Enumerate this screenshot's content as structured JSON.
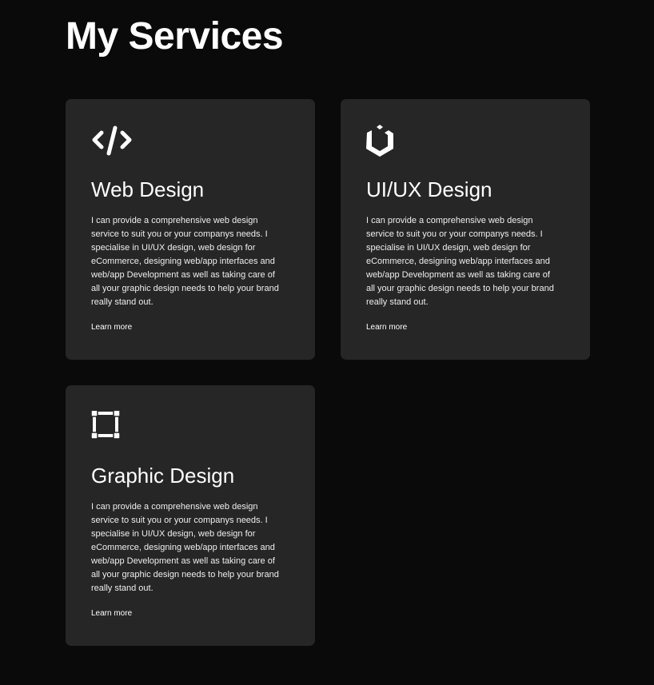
{
  "page": {
    "title": "My Services"
  },
  "services": [
    {
      "icon": "code-icon",
      "title": "Web Design",
      "description": "I can provide a comprehensive web design service to suit you or your companys needs. I specialise in UI/UX design, web design for eCommerce, designing web/app interfaces and web/app Development as well as taking care of all your graphic design needs to help your brand really stand out.",
      "link": "Learn more"
    },
    {
      "icon": "uikit-cube-icon",
      "title": "UI/UX Design",
      "description": "I can provide a comprehensive web design service to suit you or your companys needs. I specialise in UI/UX design, web design for eCommerce, designing web/app interfaces and web/app Development as well as taking care of all your graphic design needs to help your brand really stand out.",
      "link": "Learn more"
    },
    {
      "icon": "vector-square-icon",
      "title": "Graphic Design",
      "description": "I can provide a comprehensive web design service to suit you or your companys needs. I specialise in UI/UX design, web design for eCommerce, designing web/app interfaces and web/app Development as well as taking care of all your graphic design needs to help your brand really stand out.",
      "link": "Learn more"
    }
  ],
  "colors": {
    "background": "#0a0a0a",
    "card": "#262626",
    "text": "#ffffff"
  }
}
